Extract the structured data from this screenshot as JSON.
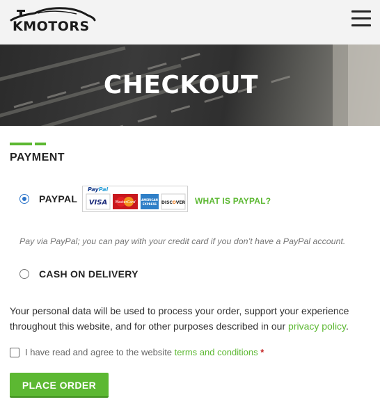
{
  "header": {
    "logo_text": "KMOTORS",
    "menu_icon": "hamburger-menu-icon"
  },
  "hero": {
    "title": "CHECKOUT"
  },
  "payment": {
    "title": "PAYMENT",
    "options": [
      {
        "label": "PAYPAL",
        "selected": true
      },
      {
        "label": "CASH ON DELIVERY",
        "selected": false
      }
    ],
    "paypal_badge": {
      "brand": "PayPal",
      "cards": [
        "VISA",
        "MasterCard",
        "AMERICAN EXPRESS",
        "DISCOVER"
      ]
    },
    "what_is_paypal": "WHAT IS PAYPAL?",
    "paypal_description": "Pay via PayPal; you can pay with your credit card if you don’t have a PayPal account."
  },
  "notice": {
    "text": "Your personal data will be used to process your order, support your experience throughout this website, and for other purposes described in our ",
    "link": "privacy policy",
    "end": "."
  },
  "terms": {
    "text": "I have read and agree to the website ",
    "link": "terms and conditions",
    "required_mark": "*"
  },
  "place_order": "PLACE ORDER",
  "colors": {
    "accent": "#5cb832",
    "radio_selected": "#2a73c9",
    "header_bg": "#f3f3f3"
  }
}
